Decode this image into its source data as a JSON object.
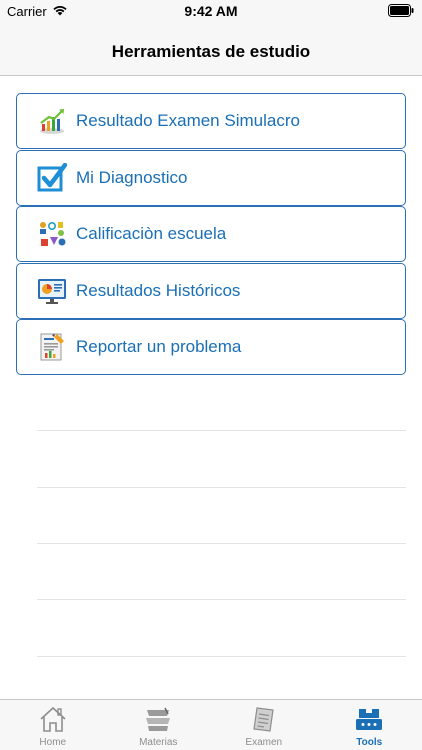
{
  "status_bar": {
    "carrier": "Carrier",
    "time": "9:42 AM",
    "wifi_icon": "wifi-icon",
    "battery_icon": "battery-icon"
  },
  "nav": {
    "title": "Herramientas de estudio"
  },
  "tools": [
    {
      "label": "Resultado Examen Simulacro",
      "icon": "chart-growth-icon"
    },
    {
      "label": "Mi Diagnostico",
      "icon": "checkbox-checked-icon"
    },
    {
      "label": "Calificaciòn escuela",
      "icon": "science-tools-icon"
    },
    {
      "label": "Resultados Históricos",
      "icon": "presentation-screen-icon"
    },
    {
      "label": "Reportar un problema",
      "icon": "report-document-icon"
    }
  ],
  "tab_bar": {
    "tabs": [
      {
        "label": "Home",
        "icon": "house-icon",
        "active": false
      },
      {
        "label": "Materias",
        "icon": "books-icon",
        "active": false
      },
      {
        "label": "Examen",
        "icon": "exam-paper-icon",
        "active": false
      },
      {
        "label": "Tools",
        "icon": "toolbox-icon",
        "active": true
      }
    ]
  },
  "colors": {
    "accent": "#1a6fb5",
    "border": "#2c6fb7",
    "bar_background": "#f7f7f7",
    "inactive_tab": "#8e8e8e"
  }
}
